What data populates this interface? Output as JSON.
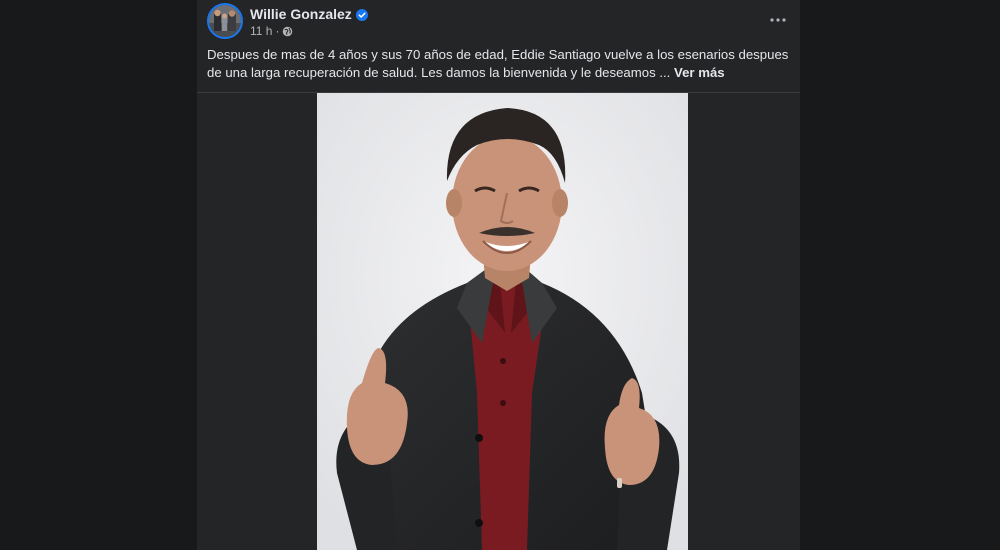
{
  "post": {
    "author": "Willie Gonzalez",
    "timestamp": "11 h",
    "meta_separator": "·",
    "privacy_icon": "globe-icon",
    "verified_icon": "verified-badge-icon",
    "more_icon": "more-options-icon",
    "text": "Despues de mas de 4 años y sus 70 años de edad, Eddie Santiago vuelve a los esenarios despues de una larga recuperación de salud. Les damos la bienvenida y le deseamos",
    "ellipsis": "...",
    "see_more_label": "Ver más"
  },
  "colors": {
    "page_background": "#18191a",
    "card_background": "#242526",
    "primary_text": "#e4e6eb",
    "secondary_text": "#b0b3b8",
    "verified_blue": "#1877f2",
    "photo_background": "#ececee"
  }
}
